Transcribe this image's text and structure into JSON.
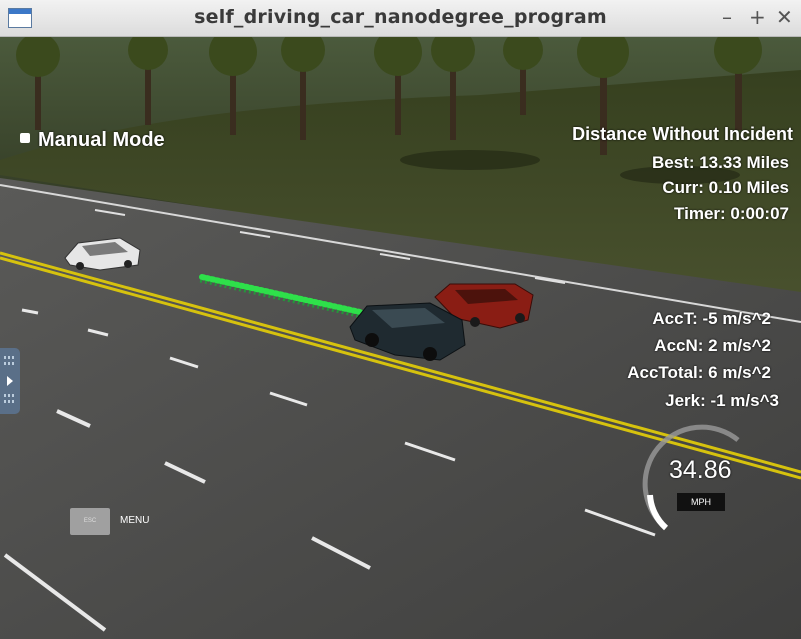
{
  "window": {
    "title": "self_driving_car_nanodegree_program",
    "buttons": {
      "minimize": "–",
      "maximize": "+",
      "close": "✕"
    }
  },
  "hud": {
    "mode_label": "Manual Mode",
    "distance_title": "Distance Without Incident",
    "best": "Best: 13.33 Miles",
    "curr": "Curr: 0.10 Miles",
    "timer": "Timer: 0:00:07",
    "acc_t": "AccT: -5 m/s^2",
    "acc_n": "AccN: 2 m/s^2",
    "acc_total": "AccTotal: 6 m/s^2",
    "jerk": "Jerk: -1 m/s^3"
  },
  "speedometer": {
    "value": "34.86",
    "unit": "MPH"
  },
  "menu": {
    "esc_label": "ESC",
    "menu_label": "MENU"
  },
  "colors": {
    "grass": "#3a3f21",
    "road": "#4a4a4a",
    "lane_yellow": "#d6c20e",
    "path_green": "#2ee04a",
    "car_dark": "#1f2a30",
    "car_red": "#8a1d14",
    "car_white": "#e8e8e8"
  }
}
